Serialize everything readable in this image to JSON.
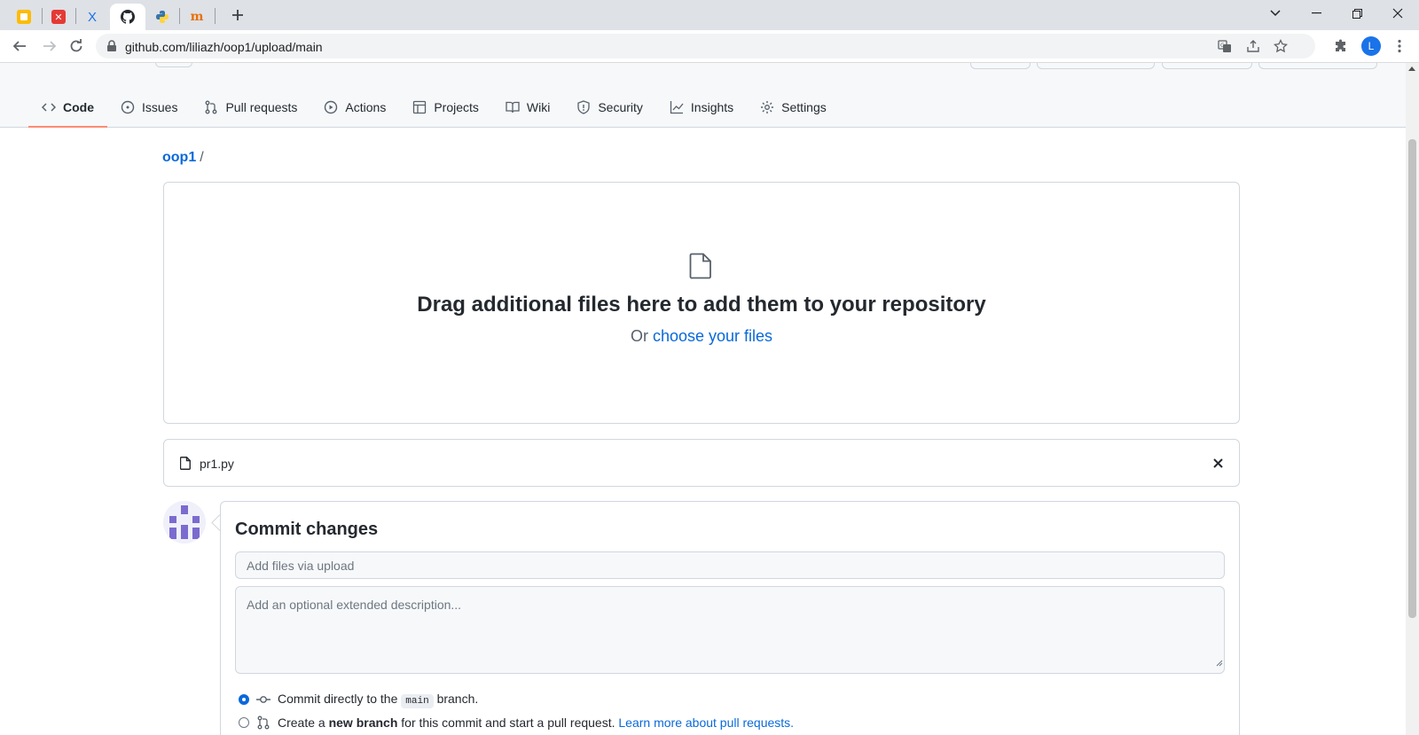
{
  "browser": {
    "url": "github.com/liliazh/oop1/upload/main",
    "profile_initial": "L",
    "tabs": [
      {
        "icon": "notes-favicon-icon"
      },
      {
        "icon": "red-app-favicon-icon"
      },
      {
        "icon": "x-favicon-icon",
        "glyph": "X"
      },
      {
        "icon": "github-favicon-icon"
      },
      {
        "icon": "python-favicon-icon"
      },
      {
        "icon": "m-favicon-icon",
        "glyph": "m"
      }
    ]
  },
  "repo_nav": {
    "tabs": [
      {
        "label": "Code",
        "icon": "code-icon",
        "selected": true
      },
      {
        "label": "Issues",
        "icon": "issue-icon"
      },
      {
        "label": "Pull requests",
        "icon": "pull-request-icon"
      },
      {
        "label": "Actions",
        "icon": "play-icon"
      },
      {
        "label": "Projects",
        "icon": "table-icon"
      },
      {
        "label": "Wiki",
        "icon": "book-icon"
      },
      {
        "label": "Security",
        "icon": "shield-icon"
      },
      {
        "label": "Insights",
        "icon": "graph-icon"
      },
      {
        "label": "Settings",
        "icon": "gear-icon"
      }
    ]
  },
  "breadcrumb": {
    "repo": "oop1",
    "separator": "/"
  },
  "dropzone": {
    "title": "Drag additional files here to add them to your repository",
    "prefix": "Or",
    "link": "choose your files"
  },
  "uploaded_files": [
    {
      "name": "pr1.py"
    }
  ],
  "commit": {
    "title": "Commit changes",
    "summary_placeholder": "Add files via upload",
    "description_placeholder": "Add an optional extended description...",
    "option_direct": {
      "prefix": "Commit directly to the",
      "branch": "main",
      "suffix": "branch."
    },
    "option_new": {
      "prefix": "Create a",
      "bold": "new branch",
      "middle": "for this commit and start a pull request.",
      "link": "Learn more about pull requests."
    }
  },
  "colors": {
    "accent": "#0969da",
    "selected_tab_underline": "#fd8c73"
  }
}
